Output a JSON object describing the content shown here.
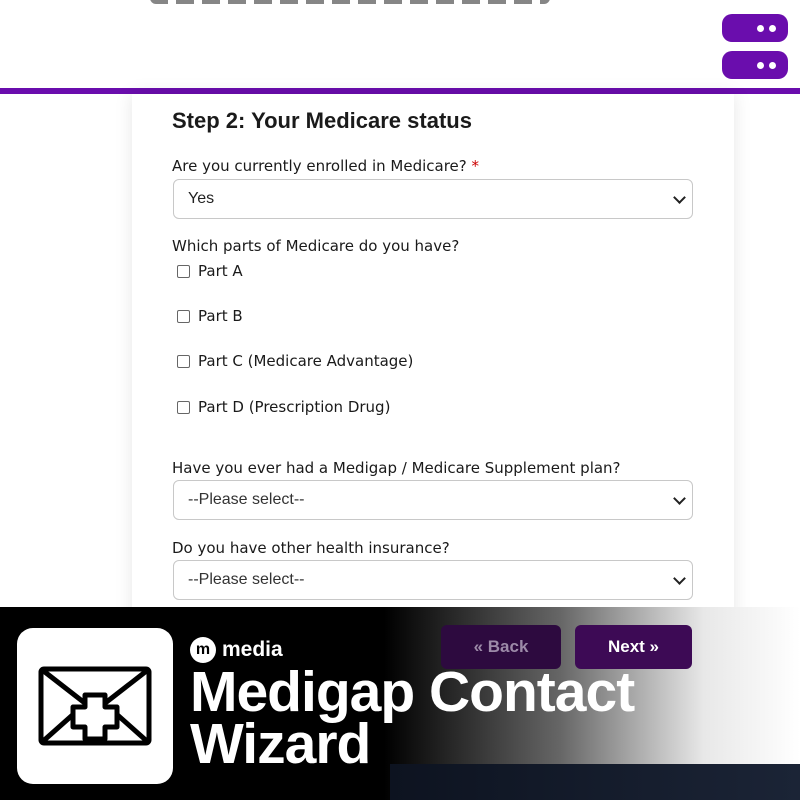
{
  "header": {
    "menu_pills": [
      "menu-toggle",
      "menu-toggle"
    ]
  },
  "form": {
    "step_title": "Step 2: Your Medicare status",
    "q_enrolled": {
      "label": "Are you currently enrolled in Medicare?",
      "required_mark": "*",
      "value": "Yes"
    },
    "q_parts": {
      "label": "Which parts of Medicare do you have?",
      "options": [
        {
          "label": "Part A",
          "checked": false
        },
        {
          "label": "Part B",
          "checked": false
        },
        {
          "label": "Part C (Medicare Advantage)",
          "checked": false
        },
        {
          "label": "Part D (Prescription Drug)",
          "checked": false
        }
      ]
    },
    "q_medigap": {
      "label": "Have you ever had a Medigap / Medicare Supplement plan?",
      "value": "--Please select--"
    },
    "q_other_insurance": {
      "label": "Do you have other health insurance?",
      "value": "--Please select--"
    }
  },
  "nav": {
    "back_label": "« Back",
    "next_label": "Next »"
  },
  "banner": {
    "brand_mark": "m",
    "brand_name": "media",
    "title_line1": "Medigap Contact",
    "title_line2": "Wizard",
    "icon": "envelope-medical-cross-icon"
  },
  "colors": {
    "accent_purple": "#6a0dad",
    "button_dark": "#3d0a55",
    "required_red": "#cc0000"
  }
}
